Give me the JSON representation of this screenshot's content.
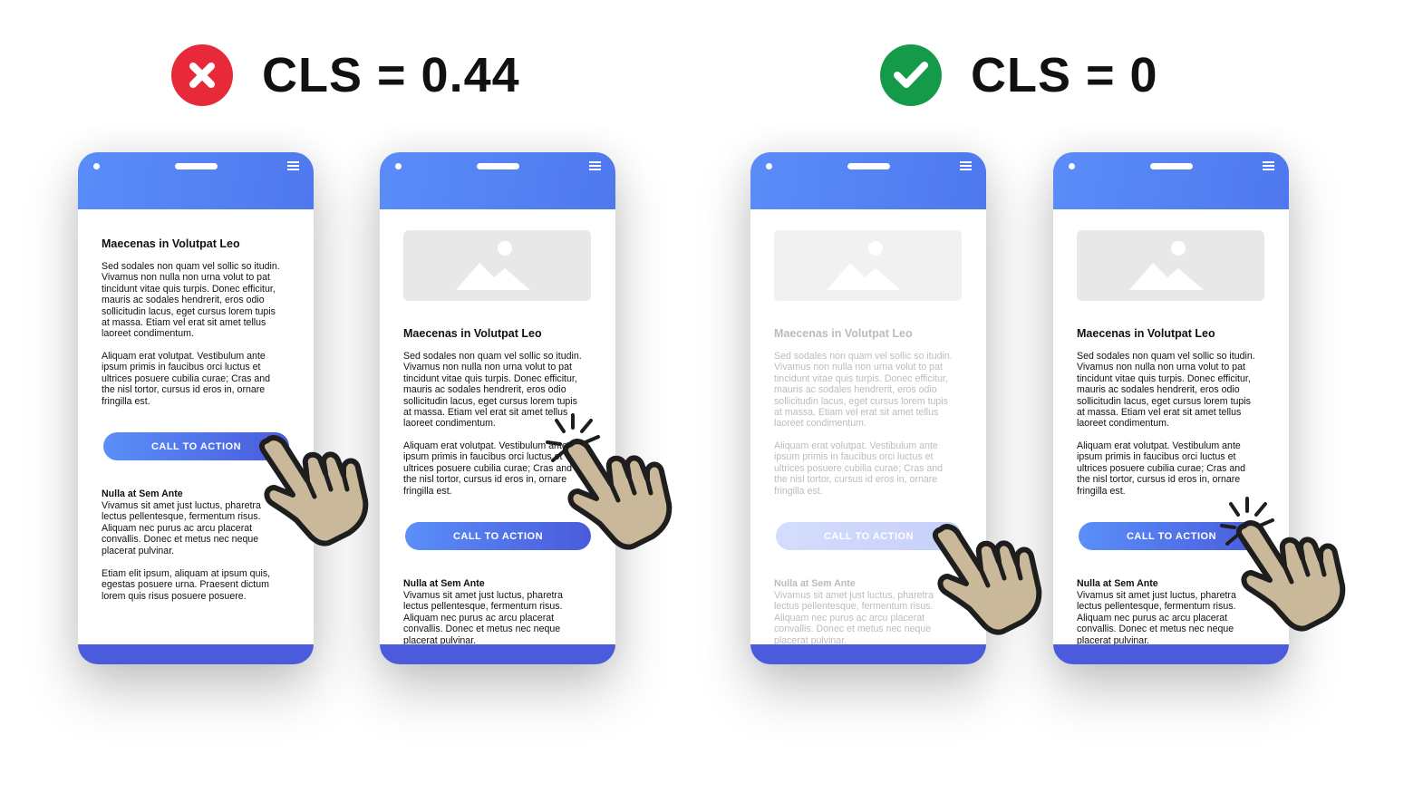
{
  "colors": {
    "bad": "#e8293a",
    "good": "#139b4a",
    "phone_header": "#5a8df9",
    "phone_footer": "#4a5bdc",
    "hand": "#c9b99a"
  },
  "headers": [
    {
      "icon": "x-circle-icon",
      "text": "CLS = 0.44"
    },
    {
      "icon": "check-circle-icon",
      "text": "CLS = 0"
    }
  ],
  "content": {
    "title": "Maecenas in Volutpat Leo",
    "para1": [
      "Sed sodales non quam vel sollic so itudin.",
      "Vivamus non nulla non urna volut to pat",
      "tincidunt vitae quis turpis. Donec efficitur,",
      "mauris ac sodales hendrerit, eros odio",
      "sollicitudin lacus, eget cursus lorem tupis",
      "at massa. Etiam vel erat sit amet tellus",
      "laoreet condimentum."
    ],
    "para2": [
      "Aliquam erat volutpat. Vestibulum ante",
      "ipsum primis in faucibus orci luctus et",
      "ultrices posuere cubilia curae; Cras and",
      "the nisl tortor, cursus id eros in, ornare",
      "fringilla est."
    ],
    "cta": "CALL TO ACTION",
    "subtitle": "Nulla at Sem Ante",
    "para3": [
      "Vivamus sit amet just luctus, pharetra",
      "lectus pellentesque, fermentum risus.",
      "Aliquam nec purus ac arcu placerat",
      "convallis. Donec et metus nec neque",
      "placerat pulvinar."
    ],
    "para4": [
      "Etiam elit ipsum, aliquam at ipsum quis,",
      "egestas posuere urna. Praesent dictum",
      "lorem quis risus posuere posuere."
    ]
  },
  "phones": [
    {
      "state": "before-shift",
      "image": false,
      "faded": false,
      "clicked": false
    },
    {
      "state": "after-shift",
      "image": true,
      "faded": false,
      "clicked": true
    },
    {
      "state": "reserved-space-loading",
      "image": true,
      "faded": true,
      "clicked": false
    },
    {
      "state": "reserved-space-loaded",
      "image": true,
      "faded": false,
      "clicked": true
    }
  ]
}
